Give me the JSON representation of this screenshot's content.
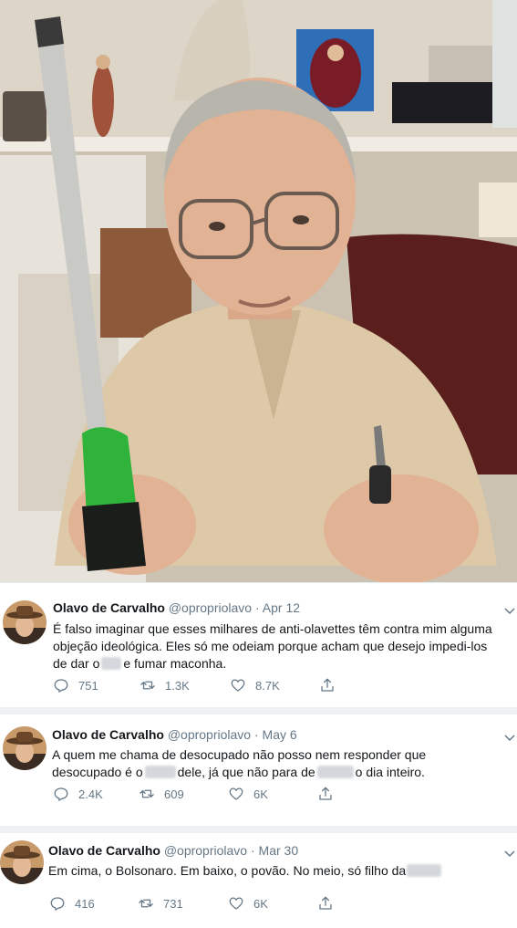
{
  "tweets": [
    {
      "name": "Olavo de Carvalho",
      "handle": "@opropriolavo",
      "sep": "·",
      "date": "Apr 12",
      "text": {
        "l1": "É falso imaginar que esses milhares de anti-olavettes têm contra mim alguma",
        "l2": "objeção ideológica. Eles só me odeiam porque acham que desejo impedi-los",
        "l3a": "de dar o",
        "l3b": "e fumar maconha."
      },
      "replies": "751",
      "retweets": "1.3K",
      "likes": "8.7K"
    },
    {
      "name": "Olavo de Carvalho",
      "handle": "@opropriolavo",
      "sep": "·",
      "date": "May 6",
      "text": {
        "l1": "A quem me chama de desocupado não posso nem responder que",
        "l2a": "desocupado é o",
        "l2b": "dele, já que não para de",
        "l2c": "o dia inteiro."
      },
      "replies": "2.4K",
      "retweets": "609",
      "likes": "6K"
    },
    {
      "name": "Olavo de Carvalho",
      "handle": "@opropriolavo",
      "sep": "·",
      "date": "Mar 30",
      "text": {
        "l1": "Em cima, o Bolsonaro. Em baixo, o povão. No meio, só filho da"
      },
      "replies": "416",
      "retweets": "731",
      "likes": "6K"
    }
  ],
  "icons": {
    "reply": "reply-icon",
    "retweet": "retweet-icon",
    "like": "heart-icon",
    "share": "share-icon",
    "more": "chevron-down-icon"
  },
  "colors": {
    "text": "#14171a",
    "secondary": "#657786",
    "divider": "#e6ecf0",
    "screwdriver_handle": "#2fb33a"
  }
}
